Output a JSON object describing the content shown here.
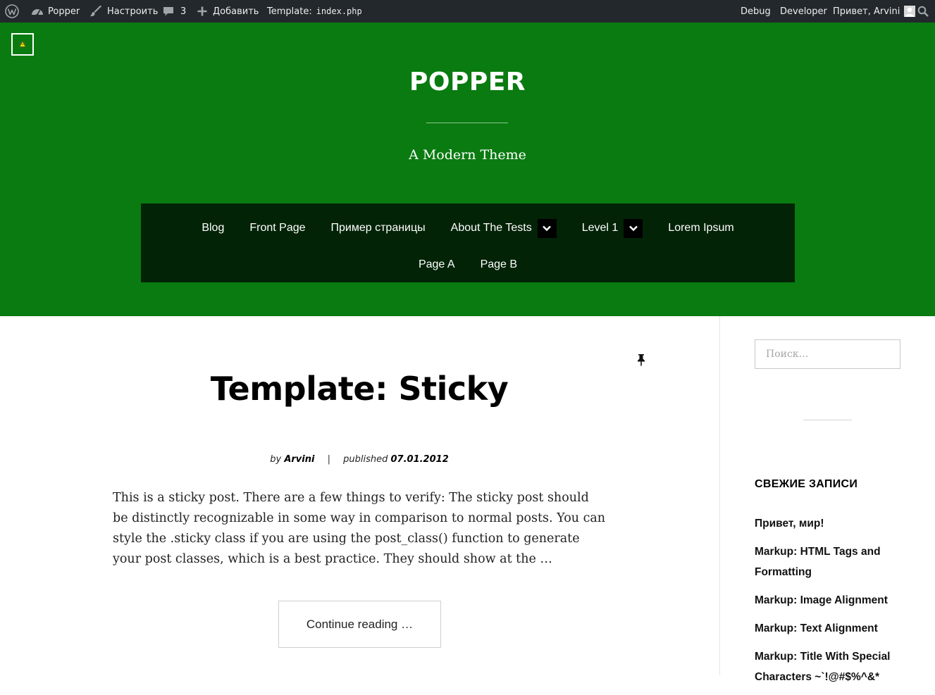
{
  "admin_bar": {
    "site_name": "Popper",
    "customize": "Настроить",
    "comments_count": "3",
    "add_new": "Добавить",
    "template_label": "Template:",
    "template_file": "index.php",
    "debug": "Debug",
    "developer": "Developer",
    "greeting": "Привет, Arvini"
  },
  "header": {
    "site_title": "POPPER",
    "tagline": "A Modern Theme",
    "background_color": "#097b10",
    "nav_background_color": "#032307"
  },
  "nav": {
    "row1": [
      {
        "label": "Blog"
      },
      {
        "label": "Front Page"
      },
      {
        "label": "Пример страницы"
      },
      {
        "label": "About The Tests",
        "has_submenu": true
      },
      {
        "label": "Level 1",
        "has_submenu": true
      },
      {
        "label": "Lorem Ipsum"
      }
    ],
    "row2": [
      {
        "label": "Page A"
      },
      {
        "label": "Page B"
      }
    ]
  },
  "post": {
    "title": "Template: Sticky",
    "by": "by",
    "author": "Arvini",
    "separator": "|",
    "published": "published",
    "date": "07.01.2012",
    "excerpt": "This is a sticky post. There are a few things to verify: The sticky post should be distinctly recognizable in some way in comparison to normal posts. You can style the .sticky class if you are using the post_class() function to generate your post classes, which is a best practice. They should show at the …",
    "continue_label": "Continue reading …"
  },
  "sidebar": {
    "search_placeholder": "Поиск…",
    "recent_title": "СВЕЖИЕ ЗАПИСИ",
    "recent_posts": [
      "Привет, мир!",
      "Markup: HTML Tags and Formatting",
      "Markup: Image Alignment",
      "Markup: Text Alignment",
      "Markup: Title With Special Characters ~`!@#$%^&*"
    ]
  }
}
